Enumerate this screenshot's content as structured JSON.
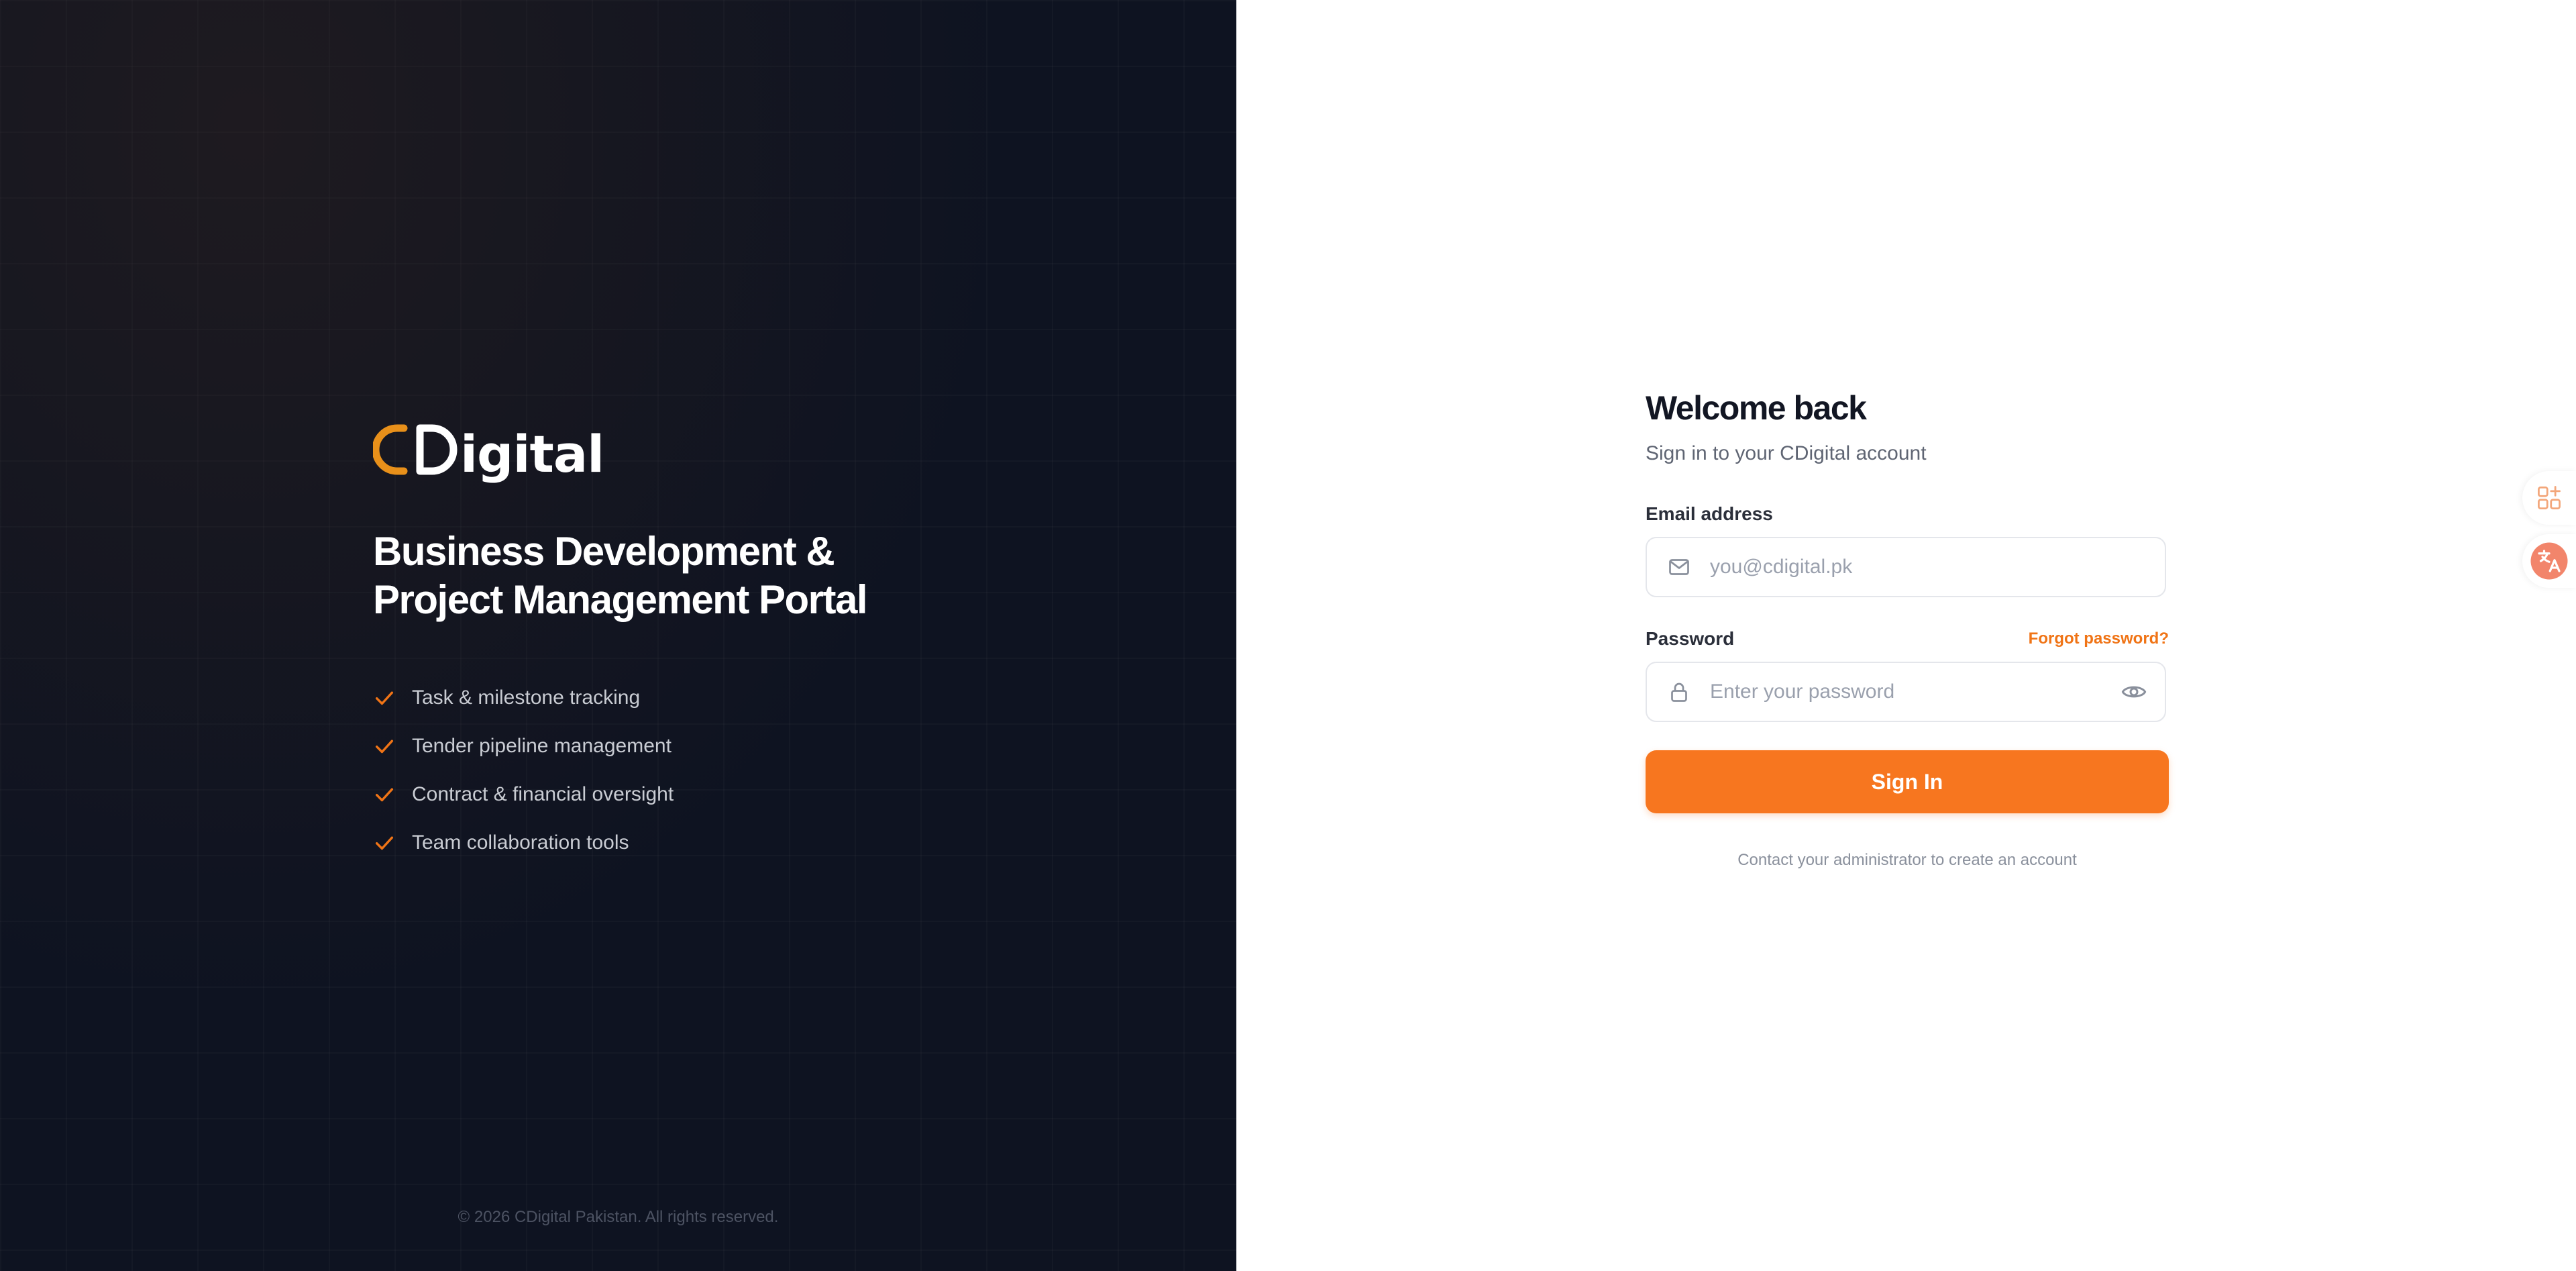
{
  "brand": {
    "name_suffix": "igital",
    "accent_color": "#e8901a"
  },
  "hero": {
    "title_line1": "Business Development &",
    "title_line2": "Project Management Portal",
    "features": [
      {
        "label": "Task & milestone tracking",
        "icon": "check-icon"
      },
      {
        "label": "Tender pipeline management",
        "icon": "check-icon"
      },
      {
        "label": "Contract & financial oversight",
        "icon": "check-icon"
      },
      {
        "label": "Team collaboration tools",
        "icon": "check-icon"
      }
    ],
    "footer": "© 2026 CDigital Pakistan. All rights reserved."
  },
  "login": {
    "heading": "Welcome back",
    "subtitle": "Sign in to your CDigital account",
    "email": {
      "label": "Email address",
      "placeholder": "you@cdigital.pk",
      "value": "",
      "icon": "mail-icon"
    },
    "password": {
      "label": "Password",
      "placeholder": "Enter your password",
      "value": "",
      "icon": "lock-icon",
      "toggle_icon": "eye-icon"
    },
    "forgot_label": "Forgot password?",
    "submit_label": "Sign In",
    "contact_note": "Contact your administrator to create an account"
  },
  "side_widgets": [
    {
      "icon": "apps-icon"
    },
    {
      "icon": "translate-icon"
    }
  ],
  "colors": {
    "accent": "#f7761f",
    "dark_bg": "#0e1321",
    "check": "#f07416"
  }
}
